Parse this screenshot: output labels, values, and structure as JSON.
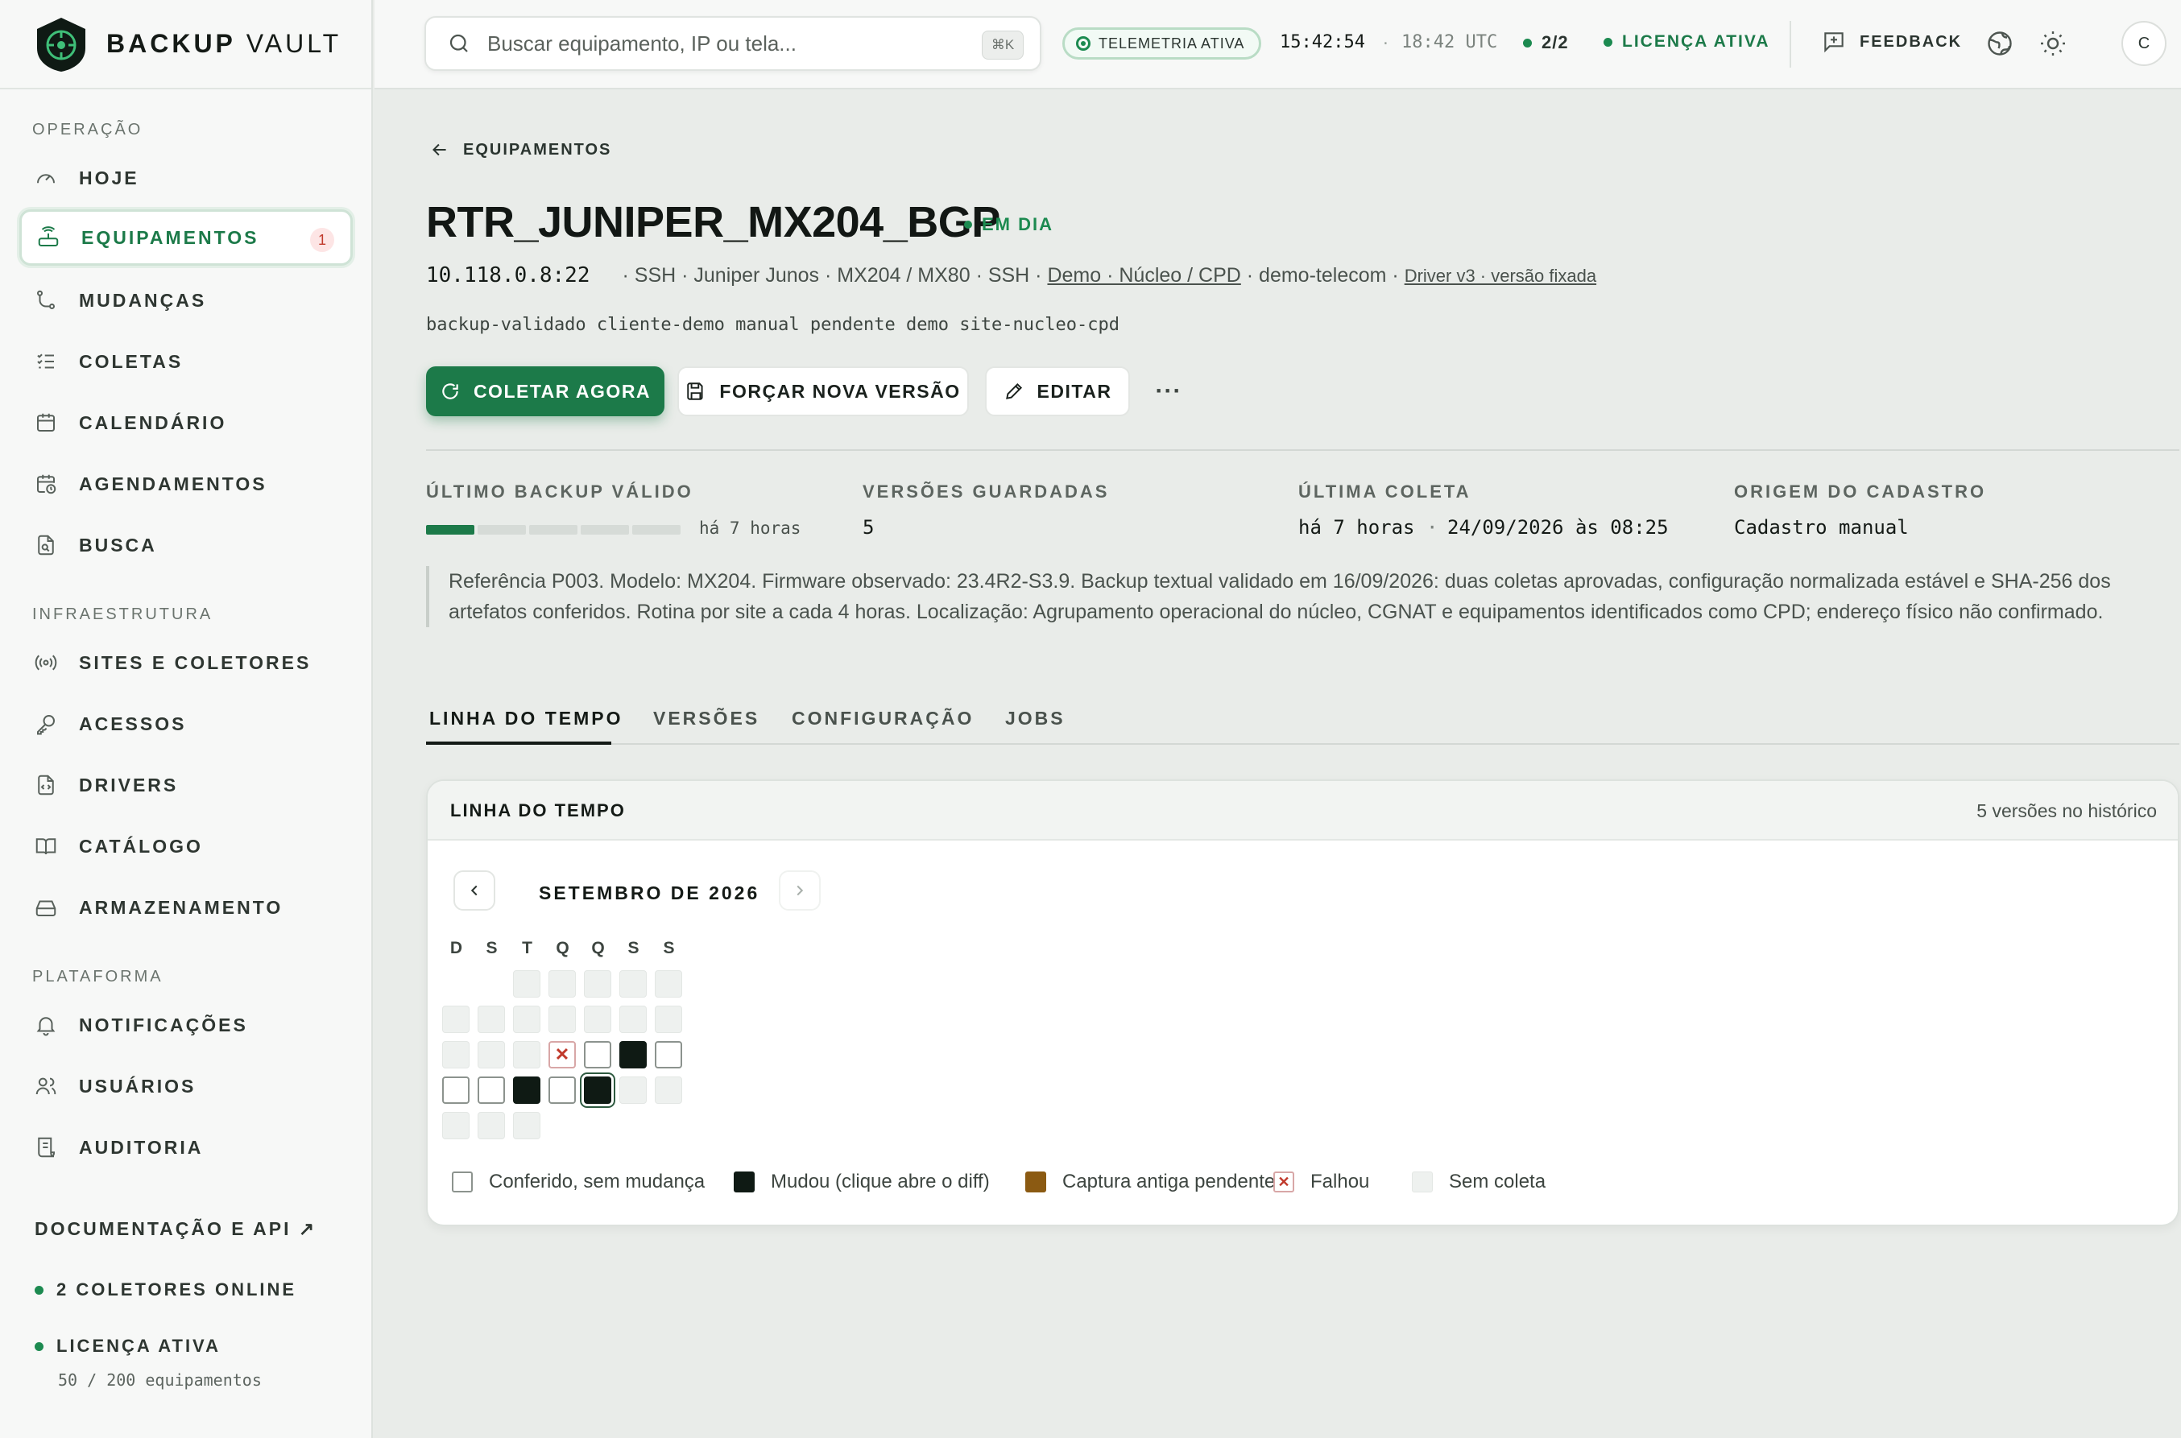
{
  "brand": {
    "name_bold": "BACKUP",
    "name_rest": "VAULT"
  },
  "sidebar": {
    "sections": [
      {
        "title": "OPERAÇÃO"
      },
      {
        "title": "INFRAESTRUTURA"
      },
      {
        "title": "PLATAFORMA"
      }
    ],
    "items": [
      {
        "label": "HOJE",
        "icon": "gauge-icon"
      },
      {
        "label": "EQUIPAMENTOS",
        "icon": "router-icon",
        "badge": "1",
        "active": true
      },
      {
        "label": "MUDANÇAS",
        "icon": "git-branch-icon"
      },
      {
        "label": "COLETAS",
        "icon": "checklist-icon"
      },
      {
        "label": "CALENDÁRIO",
        "icon": "calendar-icon"
      },
      {
        "label": "AGENDAMENTOS",
        "icon": "calendar-clock-icon"
      },
      {
        "label": "BUSCA",
        "icon": "file-search-icon"
      },
      {
        "label": "SITES E COLETORES",
        "icon": "radio-icon"
      },
      {
        "label": "ACESSOS",
        "icon": "key-icon"
      },
      {
        "label": "DRIVERS",
        "icon": "file-code-icon"
      },
      {
        "label": "CATÁLOGO",
        "icon": "book-icon"
      },
      {
        "label": "ARMAZENAMENTO",
        "icon": "hard-drive-icon"
      },
      {
        "label": "NOTIFICAÇÕES",
        "icon": "bell-icon"
      },
      {
        "label": "USUÁRIOS",
        "icon": "users-icon"
      },
      {
        "label": "AUDITORIA",
        "icon": "receipt-icon"
      }
    ],
    "docs_link": "DOCUMENTAÇÃO E API ↗",
    "collectors_status": "2 COLETORES ONLINE",
    "license_status": "LICENÇA ATIVA",
    "license_usage": "50 / 200 equipamentos"
  },
  "topbar": {
    "search_placeholder": "Buscar equipamento, IP ou tela...",
    "search_shortcut": "⌘K",
    "telemetry": "TELEMETRIA ATIVA",
    "local_time": "15:42:54",
    "separator": "·",
    "utc_time": "18:42 UTC",
    "collectors": "2/2",
    "license": "LICENÇA ATIVA",
    "feedback": "FEEDBACK",
    "avatar_initial": "C",
    "accent": "#1c8a50"
  },
  "device": {
    "back_label": "EQUIPAMENTOS",
    "name": "RTR_JUNIPER_MX204_BGP",
    "status": "EM DIA",
    "address": "10.118.0.8:22",
    "meta_plain": "· SSH · Juniper Junos · MX204 / MX80 · SSH ·",
    "site_link": "Demo · Núcleo / CPD",
    "meta_customer": "· demo-telecom ·",
    "driver_link": "Driver v3 · versão fixada",
    "tags": "backup-validado cliente-demo manual pendente demo site-nucleo-cpd",
    "actions": {
      "collect": "COLETAR AGORA",
      "force": "FORÇAR NOVA VERSÃO",
      "edit": "EDITAR",
      "more": "···"
    }
  },
  "stats": {
    "last_backup_label": "ÚLTIMO BACKUP VÁLIDO",
    "last_backup_value": "há 7 horas",
    "freshness_fraction": 0.1,
    "versions_label": "VERSÕES GUARDADAS",
    "versions_value": "5",
    "last_collect_label": "ÚLTIMA COLETA",
    "last_collect_relative": "há 7 horas",
    "last_collect_sep": "·",
    "last_collect_date": "24/09/2026 às 08:25",
    "origin_label": "ORIGEM DO CADASTRO",
    "origin_value": "Cadastro manual"
  },
  "note": "Referência P003. Modelo: MX204. Firmware observado: 23.4R2-S3.9. Backup textual validado em 16/09/2026: duas coletas aprovadas, configuração normalizada estável e SHA-256 dos artefatos conferidos. Rotina por site a cada 4 horas. Localização: Agrupamento operacional do núcleo, CGNAT e equipamentos identificados como CPD; endereço físico não confirmado.",
  "tabs": [
    {
      "label": "LINHA DO TEMPO",
      "active": true
    },
    {
      "label": "VERSÕES"
    },
    {
      "label": "CONFIGURAÇÃO"
    },
    {
      "label": "JOBS"
    }
  ],
  "timeline": {
    "title": "LINHA DO TEMPO",
    "count": "5 versões no histórico",
    "month": "SETEMBRO DE 2026",
    "weekdays": [
      "D",
      "S",
      "T",
      "Q",
      "Q",
      "S",
      "S"
    ],
    "weeks": [
      [
        null,
        null,
        "none",
        "none",
        "none",
        "none",
        "none"
      ],
      [
        "none",
        "none",
        "none",
        "none",
        "none",
        "none",
        "none"
      ],
      [
        "none",
        "none",
        "none",
        "fail",
        "ok",
        "changed",
        "ok"
      ],
      [
        "ok",
        "ok",
        "changed",
        "ok",
        "changed-selected",
        "none",
        "none"
      ],
      [
        "none",
        "none",
        "none",
        null,
        null,
        null,
        null
      ]
    ],
    "legend": [
      {
        "label": "Conferido, sem mudança",
        "kind": "ok"
      },
      {
        "label": "Mudou (clique abre o diff)",
        "kind": "changed",
        "color": "#0f1a14"
      },
      {
        "label": "Captura antiga pendente",
        "kind": "pending",
        "color": "#8b5a12"
      },
      {
        "label": "Falhou",
        "kind": "fail",
        "color": "#c0392b"
      },
      {
        "label": "Sem coleta",
        "kind": "none"
      }
    ]
  }
}
